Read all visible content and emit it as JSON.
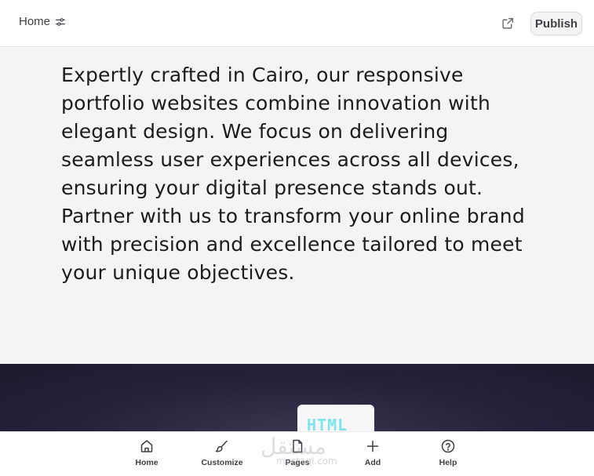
{
  "header": {
    "home_label": "Home",
    "publish_label": "Publish",
    "icons": {
      "home_settings": "sliders-icon",
      "external": "external-link-icon"
    }
  },
  "main": {
    "paragraph": "Expertly crafted in Cairo, our responsive portfolio websites combine innovation with elegant design. We focus on delivering seamless user experiences across all devices, ensuring your digital presence stands out. Partner with us to transform your online brand with precision and excellence tailored to meet your unique objectives."
  },
  "hero": {
    "card_label": "HTML",
    "colors": {
      "background": "#24213a",
      "card_text": "#7ee3ee"
    }
  },
  "bottom_nav": {
    "items": [
      {
        "label": "Home",
        "icon": "home-icon"
      },
      {
        "label": "Customize",
        "icon": "brush-icon"
      },
      {
        "label": "Pages",
        "icon": "page-icon"
      },
      {
        "label": "Add",
        "icon": "plus-icon"
      },
      {
        "label": "Help",
        "icon": "help-circle-icon"
      }
    ]
  },
  "watermark": {
    "arabic": "مستقل",
    "latin": "mostaql.com"
  }
}
